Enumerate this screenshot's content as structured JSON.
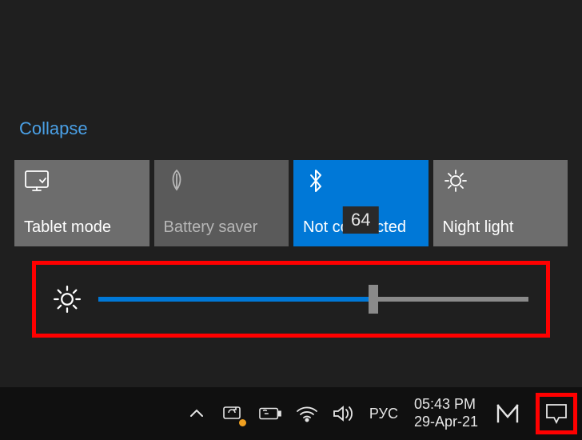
{
  "collapse_label": "Collapse",
  "tiles": {
    "tablet_mode": {
      "label": "Tablet mode"
    },
    "battery_saver": {
      "label": "Battery saver"
    },
    "bluetooth": {
      "label": "Not connected"
    },
    "night_light": {
      "label": "Night light"
    }
  },
  "brightness": {
    "value": 64,
    "min": 0,
    "max": 100,
    "tooltip": "64"
  },
  "taskbar": {
    "language": "РУС",
    "time": "05:43 PM",
    "date": "29-Apr-21"
  },
  "colors": {
    "accent": "#0078d7",
    "highlight_border": "#ff0000"
  }
}
